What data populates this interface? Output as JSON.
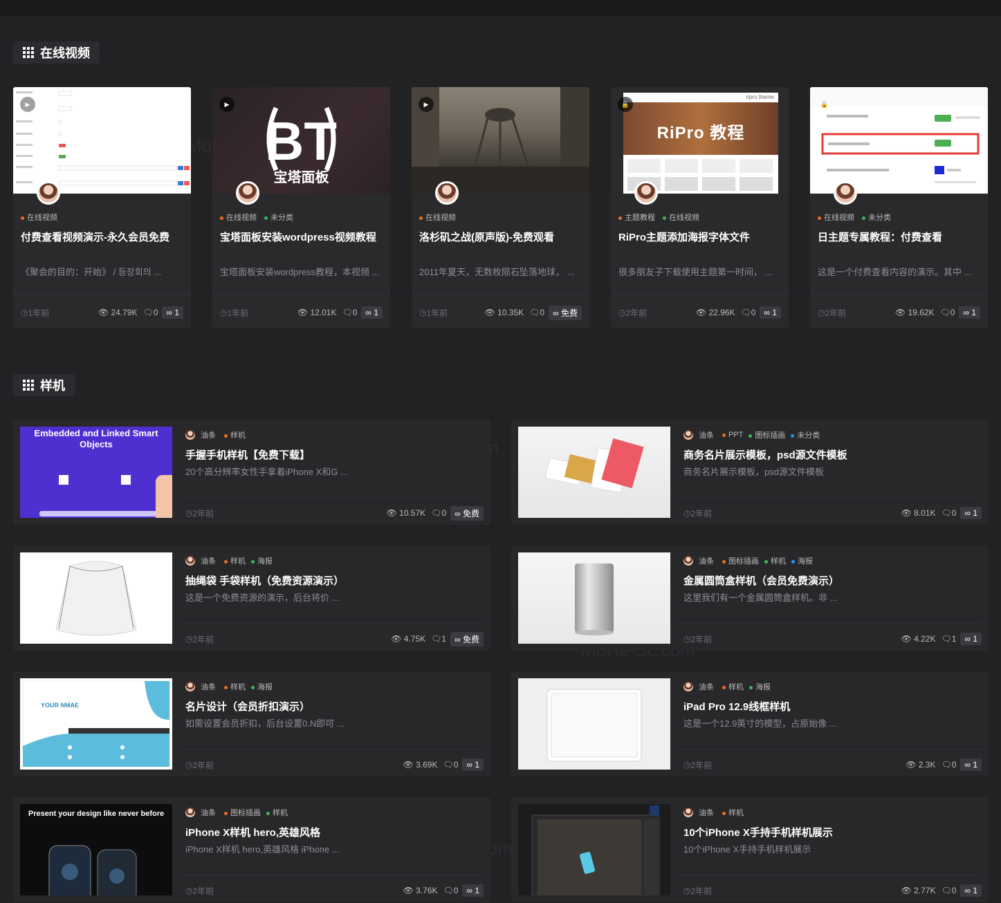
{
  "sections": {
    "video_title": "在线视频",
    "phone_title": "样机"
  },
  "colors": {
    "orange": "#f26d21",
    "green": "#3cb85c",
    "blue": "#2196f3",
    "bg": "#222225",
    "card": "#2a2a2d"
  },
  "video_cards": [
    {
      "cats": [
        {
          "label": "在线视频",
          "color": "orange"
        }
      ],
      "title": "付费查看视频演示-永久会员免费",
      "excerpt": "《聚会的目的：开始》 / 등장회의 ...",
      "time": "1年前",
      "views": "24.79K",
      "comments": "0",
      "badge": "1"
    },
    {
      "cats": [
        {
          "label": "在线视频",
          "color": "orange"
        },
        {
          "label": "未分类",
          "color": "green"
        }
      ],
      "title": "宝塔面板安装wordpress视频教程",
      "excerpt": "宝塔面板安装wordpress教程，本视频 ...",
      "time": "1年前",
      "views": "12.01K",
      "comments": "0",
      "badge": "1"
    },
    {
      "cats": [
        {
          "label": "在线视频",
          "color": "orange"
        }
      ],
      "title": "洛杉矶之战(原声版)-免费观看",
      "excerpt": "2011年夏天，无数枚陨石坠落地球，  ...",
      "time": "1年前",
      "views": "10.35K",
      "comments": "0",
      "badge": "免费"
    },
    {
      "cats": [
        {
          "label": "主题教程",
          "color": "orange"
        },
        {
          "label": "在线视频",
          "color": "green"
        }
      ],
      "title": "RiPro主题添加海报字体文件",
      "excerpt": "很多朋友子下载使用主题第一时间，  ...",
      "time": "2年前",
      "views": "22.96K",
      "comments": "0",
      "badge": "1"
    },
    {
      "cats": [
        {
          "label": "在线视频",
          "color": "orange"
        },
        {
          "label": "未分类",
          "color": "green"
        }
      ],
      "title": "日主题专属教程：付费查看",
      "excerpt": "这是一个付费查看内容的演示。其中 ...",
      "time": "2年前",
      "views": "19.62K",
      "comments": "0",
      "badge": "1"
    }
  ],
  "video_thumbs": {
    "bt_text": "宝塔面板",
    "ripro_text": "RiPro 教程",
    "ripro_header": "ripro theme"
  },
  "phone_cards": [
    {
      "author": "油条",
      "cats": [
        {
          "label": "样机",
          "color": "orange"
        }
      ],
      "title": "手握手机样机【免费下载】",
      "excerpt": "20个高分辨率女性手拿着iPhone X和G ...",
      "time": "2年前",
      "views": "10.57K",
      "comments": "0",
      "badge": "免费",
      "thumb_text": "Embedded and Linked Smart Objects"
    },
    {
      "author": "油条",
      "cats": [
        {
          "label": "PPT",
          "color": "orange"
        },
        {
          "label": "图标插画",
          "color": "green"
        },
        {
          "label": "未分类",
          "color": "blue"
        }
      ],
      "title": "商务名片展示模板，psd源文件模板",
      "excerpt": "商务名片展示模板，psd源文件模板",
      "time": "2年前",
      "views": "8.01K",
      "comments": "0",
      "badge": "1"
    },
    {
      "author": "油条",
      "cats": [
        {
          "label": "样机",
          "color": "orange"
        },
        {
          "label": "海报",
          "color": "green"
        }
      ],
      "title": "抽绳袋 手袋样机（免费资源演示）",
      "excerpt": "这是一个免费资源的演示，后台将价 ...",
      "time": "2年前",
      "views": "4.75K",
      "comments": "1",
      "badge": "免费"
    },
    {
      "author": "油条",
      "cats": [
        {
          "label": "图标插画",
          "color": "orange"
        },
        {
          "label": "样机",
          "color": "green"
        },
        {
          "label": "海报",
          "color": "blue"
        }
      ],
      "title": "金属圆筒盒样机（会员免费演示）",
      "excerpt": "这里我们有一个金属圆筒盒样机。非 ...",
      "time": "2年前",
      "views": "4.22K",
      "comments": "1",
      "badge": "1"
    },
    {
      "author": "油条",
      "cats": [
        {
          "label": "样机",
          "color": "orange"
        },
        {
          "label": "海报",
          "color": "green"
        }
      ],
      "title": "名片设计（会员折扣演示）",
      "excerpt": "如需设置会员折扣，后台设置0.N即可 ...",
      "time": "2年前",
      "views": "3.69K",
      "comments": "0",
      "badge": "1",
      "thumb_text": "YOUR NMAE"
    },
    {
      "author": "油条",
      "cats": [
        {
          "label": "样机",
          "color": "orange"
        },
        {
          "label": "海报",
          "color": "green"
        }
      ],
      "title": "iPad Pro 12.9线框样机",
      "excerpt": "这是一个12.9英寸的模型，占原始像 ...",
      "time": "2年前",
      "views": "2.3K",
      "comments": "0",
      "badge": "1"
    },
    {
      "author": "油条",
      "cats": [
        {
          "label": "图标插画",
          "color": "orange"
        },
        {
          "label": "样机",
          "color": "green"
        }
      ],
      "title": "iPhone X样机 hero,英雄风格",
      "excerpt": "iPhone X样机 hero,英雄风格 iPhone ...",
      "time": "2年前",
      "views": "3.76K",
      "comments": "0",
      "badge": "1",
      "thumb_text": "Present your design like never before"
    },
    {
      "author": "油条",
      "cats": [
        {
          "label": "样机",
          "color": "orange"
        }
      ],
      "title": "10个iPhone X手持手机样机展示",
      "excerpt": "10个iPhone X手持手机样机展示",
      "time": "2年前",
      "views": "2.77K",
      "comments": "0",
      "badge": "1"
    }
  ],
  "watermark": "MoHe-Sc.com"
}
